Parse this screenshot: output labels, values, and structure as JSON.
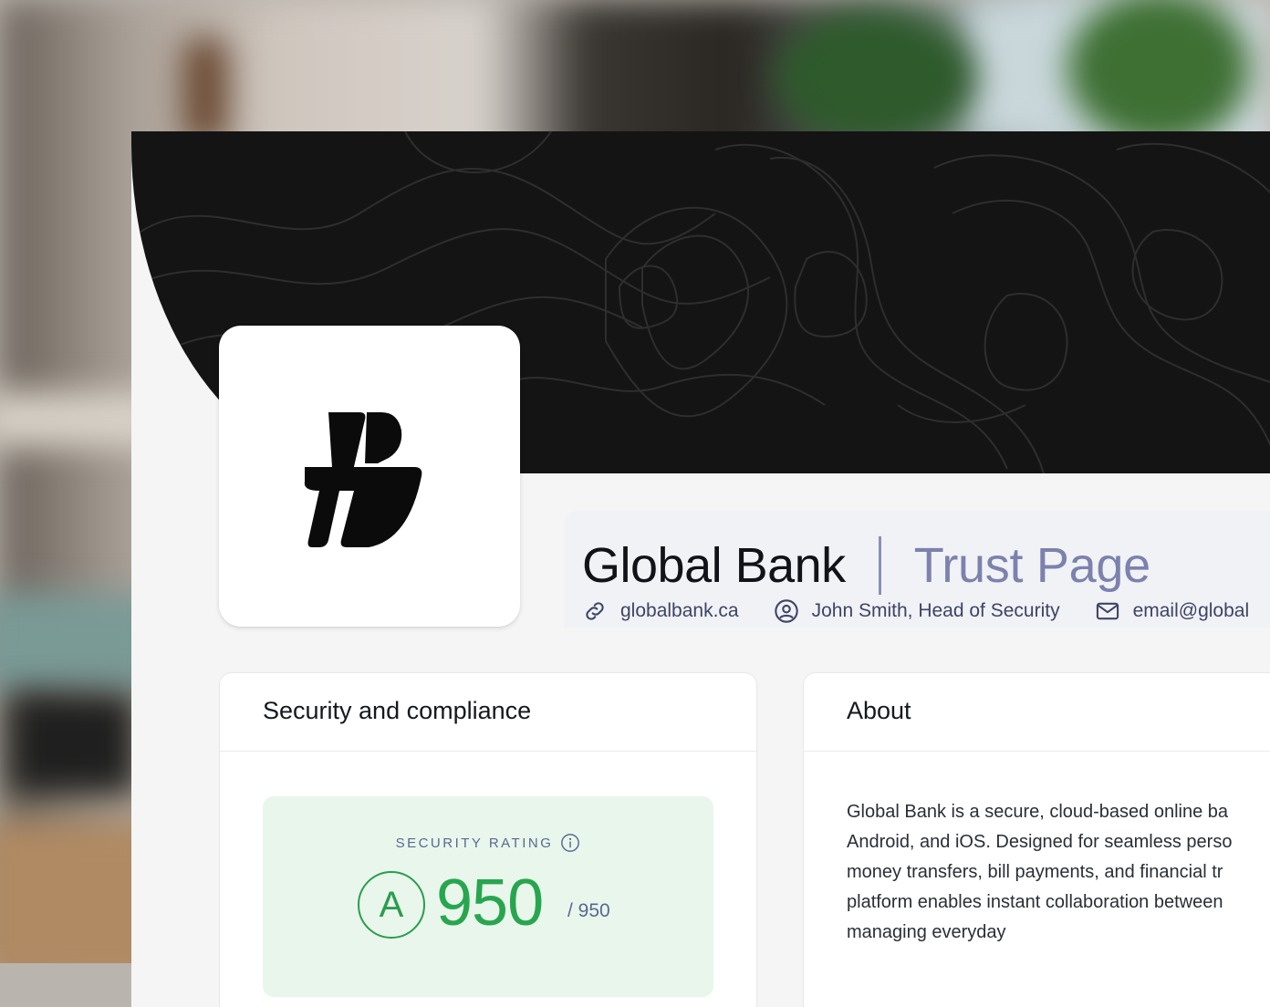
{
  "company": {
    "name": "Global Bank",
    "page_type": "Trust Page"
  },
  "meta": {
    "website": "globalbank.ca",
    "contact": "John Smith, Head of Security",
    "email": "email@global"
  },
  "security_card": {
    "title": "Security and compliance",
    "rating_label": "SECURITY RATING",
    "grade": "A",
    "score": "950",
    "score_max": "/ 950"
  },
  "about_card": {
    "title": "About",
    "lines": [
      "Global Bank is a secure, cloud-based online ba",
      "Android, and iOS. Designed for seamless perso",
      "money transfers, bill payments, and financial tr",
      "platform enables instant collaboration between",
      "managing everyday"
    ]
  },
  "icons": {
    "website": "link-icon",
    "contact": "user-circle-icon",
    "email": "mail-icon",
    "rating_info": "info-icon",
    "logo": "brand-logo"
  },
  "colors": {
    "hero_bg": "#141414",
    "accent_text": "#7c82ad",
    "rating_green": "#28a64f",
    "rating_bg": "#e9f6ec"
  }
}
